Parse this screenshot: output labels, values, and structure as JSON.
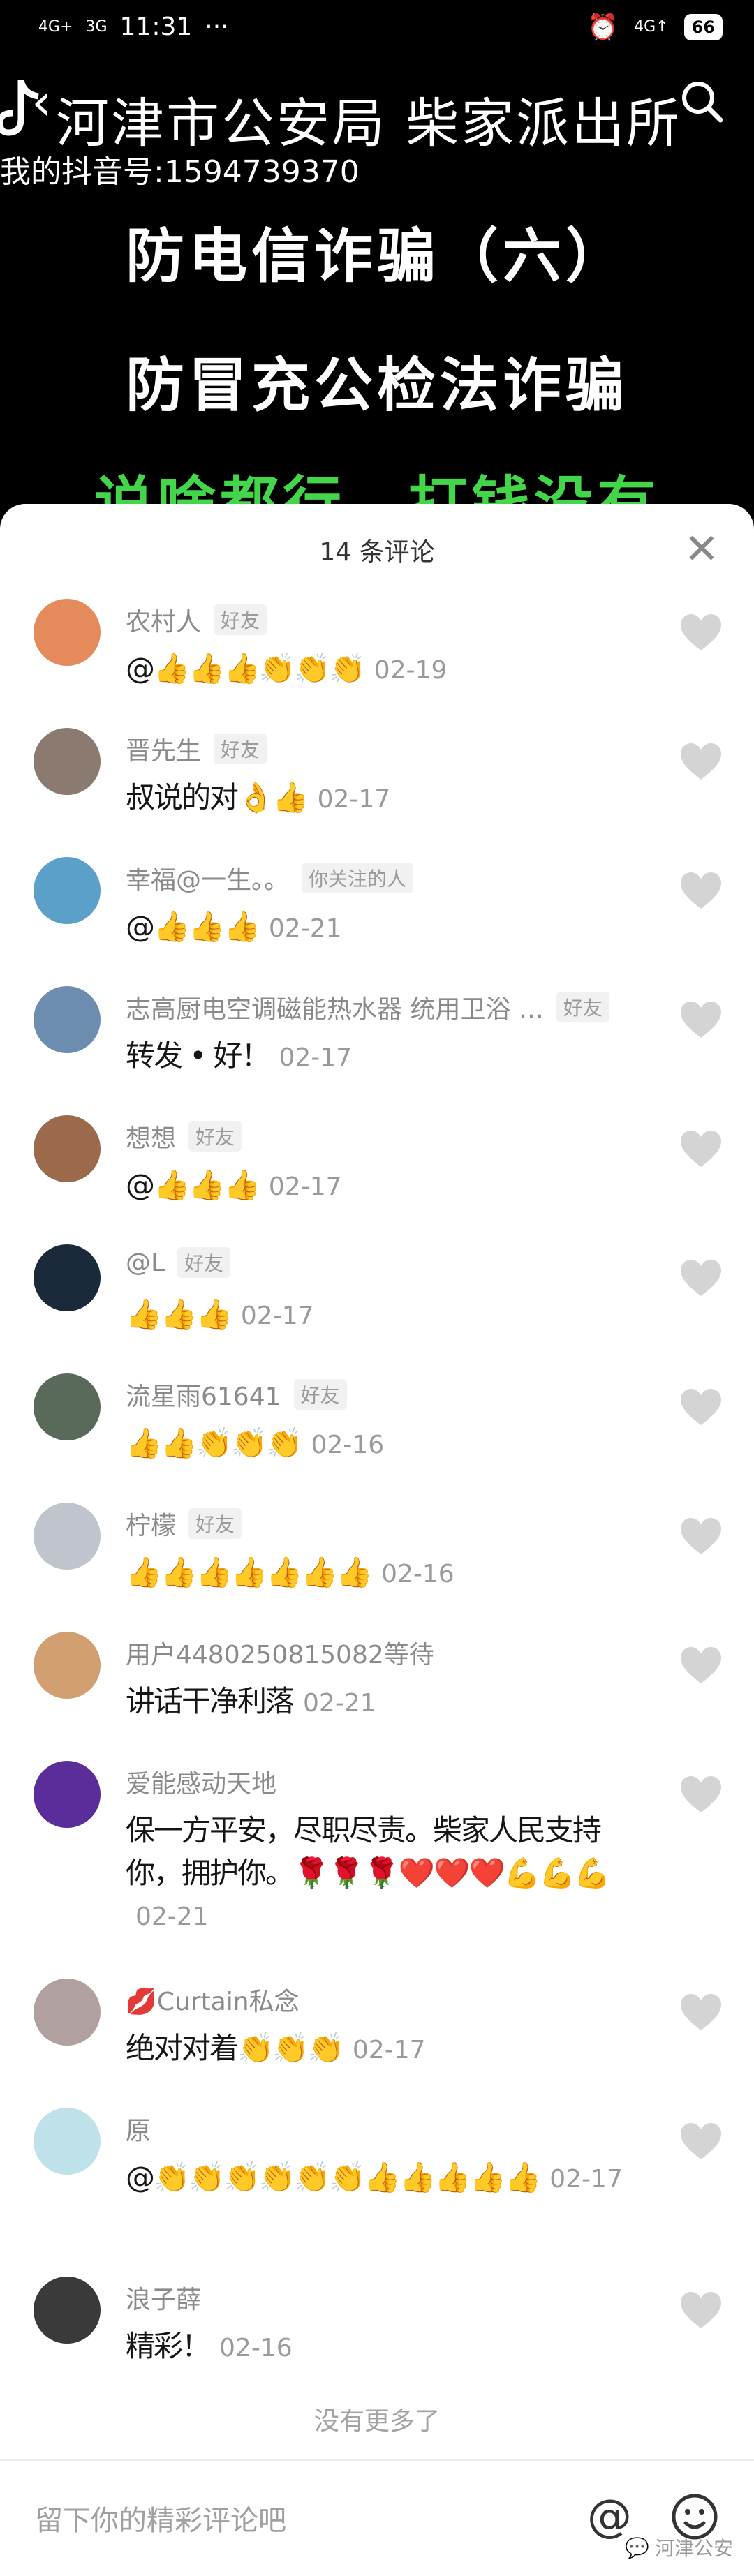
{
  "status_bar": {
    "time": "11:31",
    "signal1": "4G+",
    "signal2": "3G",
    "network": "4G↑",
    "battery": "66",
    "more": "···"
  },
  "video": {
    "title": "河津市公安局 柴家派出所",
    "handle": "我的抖音号:1594739370",
    "line1": "防电信诈骗（六）",
    "line2": "防冒充公检法诈骗",
    "line3": "说啥都行，打钱没有"
  },
  "sheet": {
    "comment_count": "14 条评论",
    "close": "✕",
    "no_more": "没有更多了",
    "input_placeholder": "留下你的精彩评论吧",
    "at_symbol": "@",
    "watermark": "河津公安"
  },
  "comments": [
    {
      "user": "农村人",
      "tag": "好友",
      "text": "@👍👍👍👏👏👏",
      "date": "02-19",
      "avatar": "#e58a5a"
    },
    {
      "user": "晋先生",
      "tag": "好友",
      "text": "叔说的对👌👍",
      "date": "02-17",
      "avatar": "#8a7a70"
    },
    {
      "user": "幸福@一生。。",
      "tag": "你关注的人",
      "text": "@👍👍👍",
      "date": "02-21",
      "avatar": "#5aa0c8"
    },
    {
      "user": "志高厨电空调磁能热水器 统用卫浴 …",
      "tag": "好友",
      "text": "转发 • 好！",
      "date": "02-17",
      "avatar": "#6c8cb0"
    },
    {
      "user": "想想",
      "tag": "好友",
      "text": "@👍👍👍",
      "date": "02-17",
      "avatar": "#9a6a4a"
    },
    {
      "user": "@L",
      "tag": "好友",
      "text": "👍👍👍",
      "date": "02-17",
      "avatar": "#1a2a3a"
    },
    {
      "user": "流星雨61641",
      "tag": "好友",
      "text": "👍👍👏👏👏",
      "date": "02-16",
      "avatar": "#5a6a5a"
    },
    {
      "user": "柠檬",
      "tag": "好友",
      "text": "👍👍👍👍👍👍👍",
      "date": "02-16",
      "avatar": "#c0c4cc"
    },
    {
      "user": "用户4480250815082等待",
      "tag": "",
      "text": "讲话干净利落",
      "date": "02-21",
      "avatar": "#d2a070"
    },
    {
      "user": "爱能感动天地",
      "tag": "",
      "text": "保一方平安，尽职尽责。柴家人民支持你，拥护你。🌹🌹🌹❤️❤️❤️💪💪💪",
      "date": "02-21",
      "avatar": "#5a2d9a"
    },
    {
      "user": "💋Curtain私念",
      "tag": "",
      "text": "绝对对着👏👏👏",
      "date": "02-17",
      "avatar": "#b0a0a0"
    },
    {
      "user": "原",
      "tag": "",
      "text": "@👏👏👏👏👏👏👍👍👍👍👍",
      "date": "02-17",
      "avatar": "#bfe2ea"
    },
    {
      "user": "浪子薛",
      "tag": "",
      "text": "精彩！",
      "date": "02-16",
      "avatar": "#3a3a3a"
    }
  ],
  "colors": {
    "accent_green": "#44d64a",
    "sheet_bg": "#ffffff",
    "like_gray": "#d4d4d4"
  }
}
